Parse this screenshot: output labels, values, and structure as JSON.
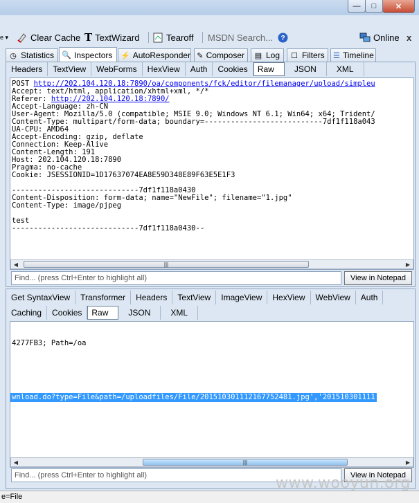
{
  "window": {
    "min_glyph": "—",
    "max_glyph": "□",
    "close_glyph": "✕"
  },
  "toolbar": {
    "clear_cache": "Clear Cache",
    "textwizard": "TextWizard",
    "tearoff": "Tearoff",
    "msdn_search": "MSDN Search...",
    "online": "Online"
  },
  "main_tabs": [
    "Statistics",
    "Inspectors",
    "AutoResponder",
    "Composer",
    "Log",
    "Filters",
    "Timeline"
  ],
  "request": {
    "tabs": [
      "Headers",
      "TextView",
      "WebForms",
      "HexView",
      "Auth",
      "Cookies",
      "Raw",
      "JSON",
      "XML"
    ],
    "method": "POST ",
    "url": "http://202.104.120.18:7890/oa/components/fck/editor/filemanager/upload/simpleu",
    "lines_1": [
      "Accept: text/html, application/xhtml+xml, */*"
    ],
    "referer_label": "Referer: ",
    "referer_url": "http://202.104.120.18:7890/",
    "lines_2": [
      "Accept-Language: zh-CN",
      "User-Agent: Mozilla/5.0 (compatible; MSIE 9.0; Windows NT 6.1; Win64; x64; Trident/",
      "Content-Type: multipart/form-data; boundary=---------------------------7df1f118a043",
      "UA-CPU: AMD64",
      "Accept-Encoding: gzip, deflate",
      "Connection: Keep-Alive",
      "Content-Length: 191",
      "Host: 202.104.120.18:7890",
      "Pragma: no-cache",
      "Cookie: JSESSIONID=1D17637074EA8E59D348E89F63E5E1F3",
      "",
      "-----------------------------7df1f118a0430",
      "Content-Disposition: form-data; name=\"NewFile\"; filename=\"1.jpg\"",
      "Content-Type: image/pjpeg",
      "",
      "test",
      "-----------------------------7df1f118a0430--"
    ],
    "find_placeholder": "Find... (press Ctrl+Enter to highlight all)",
    "view_notepad": "View in Notepad"
  },
  "response": {
    "tabs_row1": [
      "Get SyntaxView",
      "Transformer",
      "Headers",
      "TextView",
      "ImageView",
      "HexView",
      "WebView",
      "Auth"
    ],
    "tabs_row2": [
      "Caching",
      "Cookies",
      "Raw",
      "JSON",
      "XML"
    ],
    "line_cookie": "4277FB3; Path=/oa",
    "line_highlight": "wnload.do?type=File&path=/uploadfiles/File/20151030111216775248​1.jpg','201510301111",
    "find_placeholder": "Find... (press Ctrl+Enter to highlight all)",
    "view_notepad": "View in Notepad"
  },
  "watermark": "www.wooyun.org",
  "status": "e=File"
}
